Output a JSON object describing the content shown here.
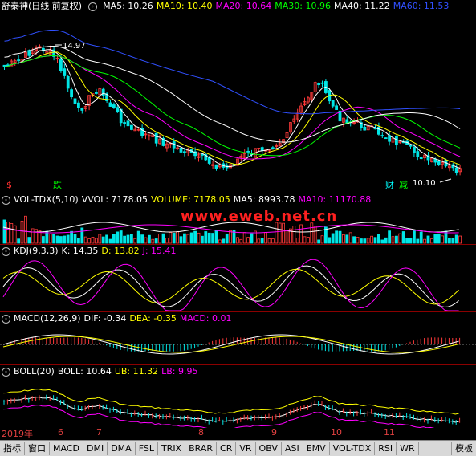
{
  "price_panel": {
    "stock_name": "舒泰神",
    "mode": "(日线 前复权)",
    "ma": [
      {
        "label": "MA5: 10.26",
        "color": "#ffffff"
      },
      {
        "label": "MA10: 10.40",
        "color": "#ffff00"
      },
      {
        "label": "MA20: 10.64",
        "color": "#ff00ff"
      },
      {
        "label": "MA30: 10.96",
        "color": "#00ff00"
      },
      {
        "label": "MA40: 11.22",
        "color": "#ffffff"
      },
      {
        "label": "MA60: 11.53",
        "color": "#3050ff"
      }
    ],
    "high_label": "14.97",
    "low_label": "10.10",
    "markers": [
      {
        "text": "$",
        "color": "#ff3030"
      },
      {
        "text": "跌",
        "color": "#00ff00"
      },
      {
        "text": "财",
        "color": "#00ffff"
      },
      {
        "text": "减",
        "color": "#00ff00"
      }
    ]
  },
  "volume_panel": {
    "items": [
      {
        "label": "VOL-TDX(5,10)",
        "color": "#ffffff"
      },
      {
        "label": "VVOL: 7178.05",
        "color": "#ffffff"
      },
      {
        "label": "VOLUME: 7178.05",
        "color": "#ffff00"
      },
      {
        "label": "MA5: 8993.78",
        "color": "#ffffff"
      },
      {
        "label": "MA10: 11170.88",
        "color": "#ff00ff"
      }
    ]
  },
  "watermark": "www.eweb.net.cn",
  "kdj_panel": {
    "items": [
      {
        "label": "KDJ(9,3,3)",
        "color": "#ffffff"
      },
      {
        "label": "K: 14.35",
        "color": "#ffffff"
      },
      {
        "label": "D: 13.82",
        "color": "#ffff00"
      },
      {
        "label": "J: 15.41",
        "color": "#ff00ff"
      }
    ]
  },
  "macd_panel": {
    "items": [
      {
        "label": "MACD(12,26,9)",
        "color": "#ffffff"
      },
      {
        "label": "DIF: -0.34",
        "color": "#ffffff"
      },
      {
        "label": "DEA: -0.35",
        "color": "#ffff00"
      },
      {
        "label": "MACD: 0.01",
        "color": "#ff00ff"
      }
    ]
  },
  "boll_panel": {
    "items": [
      {
        "label": "BOLL(20)",
        "color": "#ffffff"
      },
      {
        "label": "BOLL: 10.64",
        "color": "#ffffff"
      },
      {
        "label": "UB: 11.32",
        "color": "#ffff00"
      },
      {
        "label": "LB: 9.95",
        "color": "#ff00ff"
      }
    ]
  },
  "date_axis": [
    "2019年",
    "6",
    "7",
    "8",
    "9",
    "10",
    "11"
  ],
  "tabs": [
    "指标",
    "窗口",
    "MACD",
    "DMI",
    "DMA",
    "FSL",
    "TRIX",
    "BRAR",
    "CR",
    "VR",
    "OBV",
    "ASI",
    "EMV",
    "VOL-TDX",
    "RSI",
    "WR"
  ],
  "tab_right": "模板",
  "colors": {
    "up": "#ff3a3a",
    "down": "#00e6e6",
    "grid": "#8b0000",
    "bg": "#000000"
  }
}
